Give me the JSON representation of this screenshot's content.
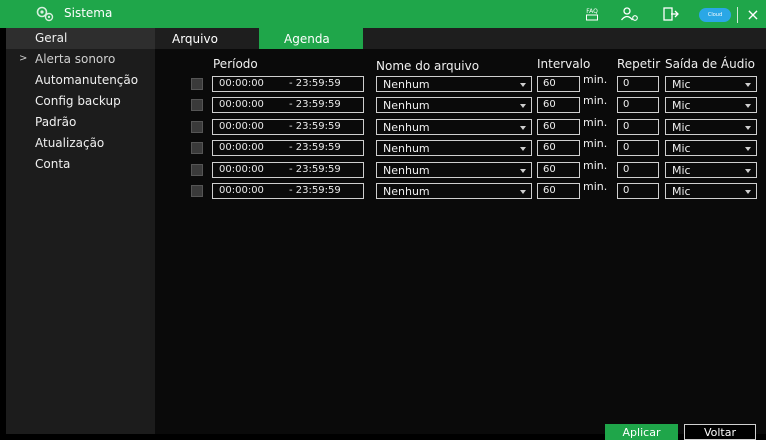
{
  "window": {
    "title": "Sistema",
    "icons": [
      "gears-icon",
      "faq-icon",
      "users-settings-icon",
      "logout-icon",
      "cloud-icon",
      "close-icon"
    ],
    "faq_label": "FAQ",
    "cloud_label": "Cloud",
    "close_glyph": "×",
    "accent_color": "#1fa64a"
  },
  "sidebar": {
    "section": "Geral",
    "items": [
      {
        "label": "Alerta sonoro",
        "active": true
      },
      {
        "label": "Automanutenção"
      },
      {
        "label": "Config backup"
      },
      {
        "label": "Padrão"
      },
      {
        "label": "Atualização"
      },
      {
        "label": "Conta"
      }
    ]
  },
  "tabs": [
    {
      "label": "Arquivo"
    },
    {
      "label": "Agenda",
      "selected": true
    }
  ],
  "table": {
    "headers": {
      "period": "Período",
      "file": "Nome do arquivo",
      "interval": "Intervalo",
      "repeat": "Repetir",
      "audio": "Saída de Áudio"
    },
    "rows": [
      {
        "start": "00:00:00",
        "end": "- 23:59:59",
        "file": "Nenhum",
        "interval": "60",
        "unit": "min.",
        "repeat": "0",
        "audio": "Mic"
      },
      {
        "start": "00:00:00",
        "end": "- 23:59:59",
        "file": "Nenhum",
        "interval": "60",
        "unit": "min.",
        "repeat": "0",
        "audio": "Mic"
      },
      {
        "start": "00:00:00",
        "end": "- 23:59:59",
        "file": "Nenhum",
        "interval": "60",
        "unit": "min.",
        "repeat": "0",
        "audio": "Mic"
      },
      {
        "start": "00:00:00",
        "end": "- 23:59:59",
        "file": "Nenhum",
        "interval": "60",
        "unit": "min.",
        "repeat": "0",
        "audio": "Mic"
      },
      {
        "start": "00:00:00",
        "end": "- 23:59:59",
        "file": "Nenhum",
        "interval": "60",
        "unit": "min.",
        "repeat": "0",
        "audio": "Mic"
      },
      {
        "start": "00:00:00",
        "end": "- 23:59:59",
        "file": "Nenhum",
        "interval": "60",
        "unit": "min.",
        "repeat": "0",
        "audio": "Mic"
      }
    ]
  },
  "footer": {
    "apply": "Aplicar",
    "back": "Voltar"
  }
}
